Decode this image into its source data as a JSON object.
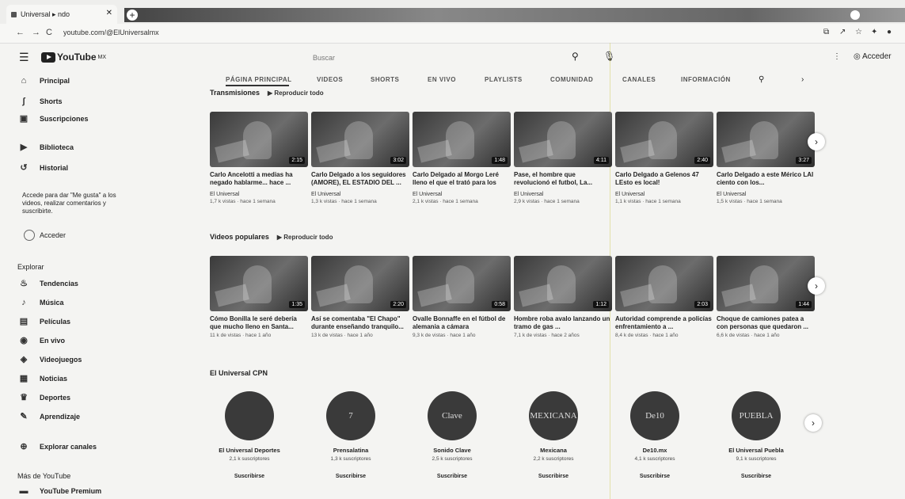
{
  "browser": {
    "tab_title": "Universal ▸ ndo",
    "url": "youtube.com/@ElUniversalmx",
    "new_tab": "+",
    "close": "✕"
  },
  "header": {
    "logo_text": "YouTube",
    "logo_region": "MX",
    "search_placeholder": "Buscar",
    "signin": "Acceder"
  },
  "sidebar": {
    "items_top": [
      {
        "label": "Principal",
        "icon": "home-icon",
        "glyph": "⌂"
      },
      {
        "label": "Shorts",
        "icon": "shorts-icon",
        "glyph": "ʃ"
      },
      {
        "label": "Suscripciones",
        "icon": "subscriptions-icon",
        "glyph": "▣"
      }
    ],
    "items_library": [
      {
        "label": "Biblioteca",
        "icon": "library-icon",
        "glyph": "▶"
      },
      {
        "label": "Historial",
        "icon": "history-icon",
        "glyph": "↺"
      }
    ],
    "signin_prompt": "Accede para dar \"Me gusta\" a los videos, realizar comentarios y suscribirte.",
    "signin_button": "Acceder",
    "explore_heading": "Explorar",
    "explore": [
      {
        "label": "Tendencias",
        "icon": "trending-icon",
        "glyph": "♨"
      },
      {
        "label": "Música",
        "icon": "music-icon",
        "glyph": "♪"
      },
      {
        "label": "Películas",
        "icon": "movies-icon",
        "glyph": "▤"
      },
      {
        "label": "En vivo",
        "icon": "live-icon",
        "glyph": "◉"
      },
      {
        "label": "Videojuegos",
        "icon": "gaming-icon",
        "glyph": "◈"
      },
      {
        "label": "Noticias",
        "icon": "news-icon",
        "glyph": "▦"
      },
      {
        "label": "Deportes",
        "icon": "sports-icon",
        "glyph": "♛"
      },
      {
        "label": "Aprendizaje",
        "icon": "learning-icon",
        "glyph": "✎"
      }
    ],
    "browse_channels": "Explorar canales",
    "more_heading": "Más de YouTube",
    "more": [
      {
        "label": "YouTube Premium",
        "icon": "premium-icon",
        "glyph": "▬"
      }
    ]
  },
  "channel_tabs": [
    "PÁGINA PRINCIPAL",
    "VIDEOS",
    "SHORTS",
    "EN VIVO",
    "PLAYLISTS",
    "COMUNIDAD",
    "CANALES",
    "INFORMACIÓN"
  ],
  "shelf1": {
    "title": "Transmisiones",
    "play_all": "Reproducir todo",
    "videos": [
      {
        "title": "Carlo Ancelotti a medias ha negado hablarme... hace ...",
        "channel": "El Universal",
        "meta": "1,7 k vistas · hace 1 semana",
        "duration": "2:15"
      },
      {
        "title": "Carlo Delgado a los seguidores (AMORE), EL ESTADIO DEL ...",
        "channel": "El Universal",
        "meta": "1,3 k vistas · hace 1 semana",
        "duration": "3:02"
      },
      {
        "title": "Carlo Delgado al Morgo Leré lleno el que el trató para los",
        "channel": "El Universal",
        "meta": "2,1 k vistas · hace 1 semana",
        "duration": "1:48"
      },
      {
        "title": "Pase, el hombre que revolucionó el futbol, La...",
        "channel": "El Universal",
        "meta": "2,9 k vistas · hace 1 semana",
        "duration": "4:11"
      },
      {
        "title": "Carlo Delgado a Gelenos 47 LEsto es local!",
        "channel": "El Universal",
        "meta": "1,1 k vistas · hace 1 semana",
        "duration": "2:40"
      },
      {
        "title": "Carlo Delgado a este Mérico LAI ciento con los...",
        "channel": "El Universal",
        "meta": "1,5 k vistas · hace 1 semana",
        "duration": "3:27"
      }
    ]
  },
  "shelf2": {
    "title": "Videos populares",
    "play_all": "Reproducir todo",
    "videos": [
      {
        "title": "Cómo Bonilla le seré debería que mucho lleno en Santa...",
        "channel": "",
        "meta": "11 k de vistas · hace 1 año",
        "duration": "1:35"
      },
      {
        "title": "Así se comentaba \"El Chapo\" durante enseñando tranquilo...",
        "channel": "",
        "meta": "13 k de vistas · hace 1 año",
        "duration": "2:20"
      },
      {
        "title": "Ovalle Bonnaffe en el fútbol de alemania a cámara",
        "channel": "",
        "meta": "9,3 k de vistas · hace 1 año",
        "duration": "0:58"
      },
      {
        "title": "Hombre roba avalo lanzando un tramo de gas ...",
        "channel": "",
        "meta": "7,1 k de vistas · hace 2 años",
        "duration": "1:12"
      },
      {
        "title": "Autoridad comprende a policías enfrentamiento a ...",
        "channel": "",
        "meta": "8,4 k de vistas · hace 1 año",
        "duration": "2:03"
      },
      {
        "title": "Choque de camiones patea a con personas que quedaron ...",
        "channel": "",
        "meta": "6,6 k de vistas · hace 1 año",
        "duration": "1:44"
      }
    ]
  },
  "channels_shelf": {
    "title": "El Universal CPN",
    "channels": [
      {
        "name": "El Universal Deportes",
        "subs": "2,1 k suscriptores",
        "avatar_text": "",
        "button": "Suscribirse"
      },
      {
        "name": "Prensalatina",
        "subs": "1,3 k suscriptores",
        "avatar_text": "7",
        "button": "Suscribirse"
      },
      {
        "name": "Sonido Clave",
        "subs": "2,5 k suscriptores",
        "avatar_text": "Clave",
        "button": "Suscribirse"
      },
      {
        "name": "Mexicana",
        "subs": "2,2 k suscriptores",
        "avatar_text": "MEXICANA",
        "button": "Suscribirse"
      },
      {
        "name": "De10.mx",
        "subs": "4,1 k suscriptores",
        "avatar_text": "De10",
        "button": "Suscribirse"
      },
      {
        "name": "El Universal Puebla",
        "subs": "9,1 k suscriptores",
        "avatar_text": "PUEBLA",
        "button": "Suscribirse"
      }
    ]
  }
}
